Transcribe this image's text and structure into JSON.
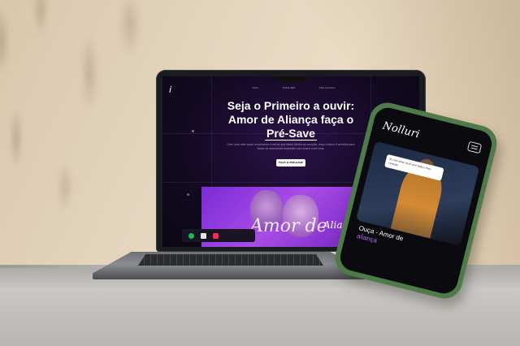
{
  "laptop": {
    "site": {
      "logo": "i",
      "nav": [
        "Início",
        "Sobre Nós",
        "Fale Conosco"
      ],
      "hero_line1": "Seja o Primeiro a ouvir:",
      "hero_line2": "Amor de Aliança faça o",
      "hero_highlight": "Pré-Save",
      "description": "Com uma vibe super envolvente e letras que falam direto ao coração, essa música é perfeita para todos os momentos especiais com quem você ama.",
      "cta_label": "FAÇA O PRÉ-SAVE",
      "cover_title_script": "Amor de",
      "cover_title_script2": "Aliança"
    },
    "player_icons": [
      {
        "name": "spotify-icon",
        "color": "#1db954"
      },
      {
        "name": "deezer-icon",
        "color": "#e6e6e6"
      },
      {
        "name": "apple-music-icon",
        "color": "#fa2d48"
      }
    ]
  },
  "phone": {
    "logo": "Nolluri",
    "bubble_text": "Eu vou amar você com todo o meu coração",
    "caption_line1": "Ouça - Amor de",
    "caption_line2": "aliança"
  },
  "colors": {
    "accent_purple": "#a94ce8",
    "phone_case": "#4f7a4a"
  }
}
